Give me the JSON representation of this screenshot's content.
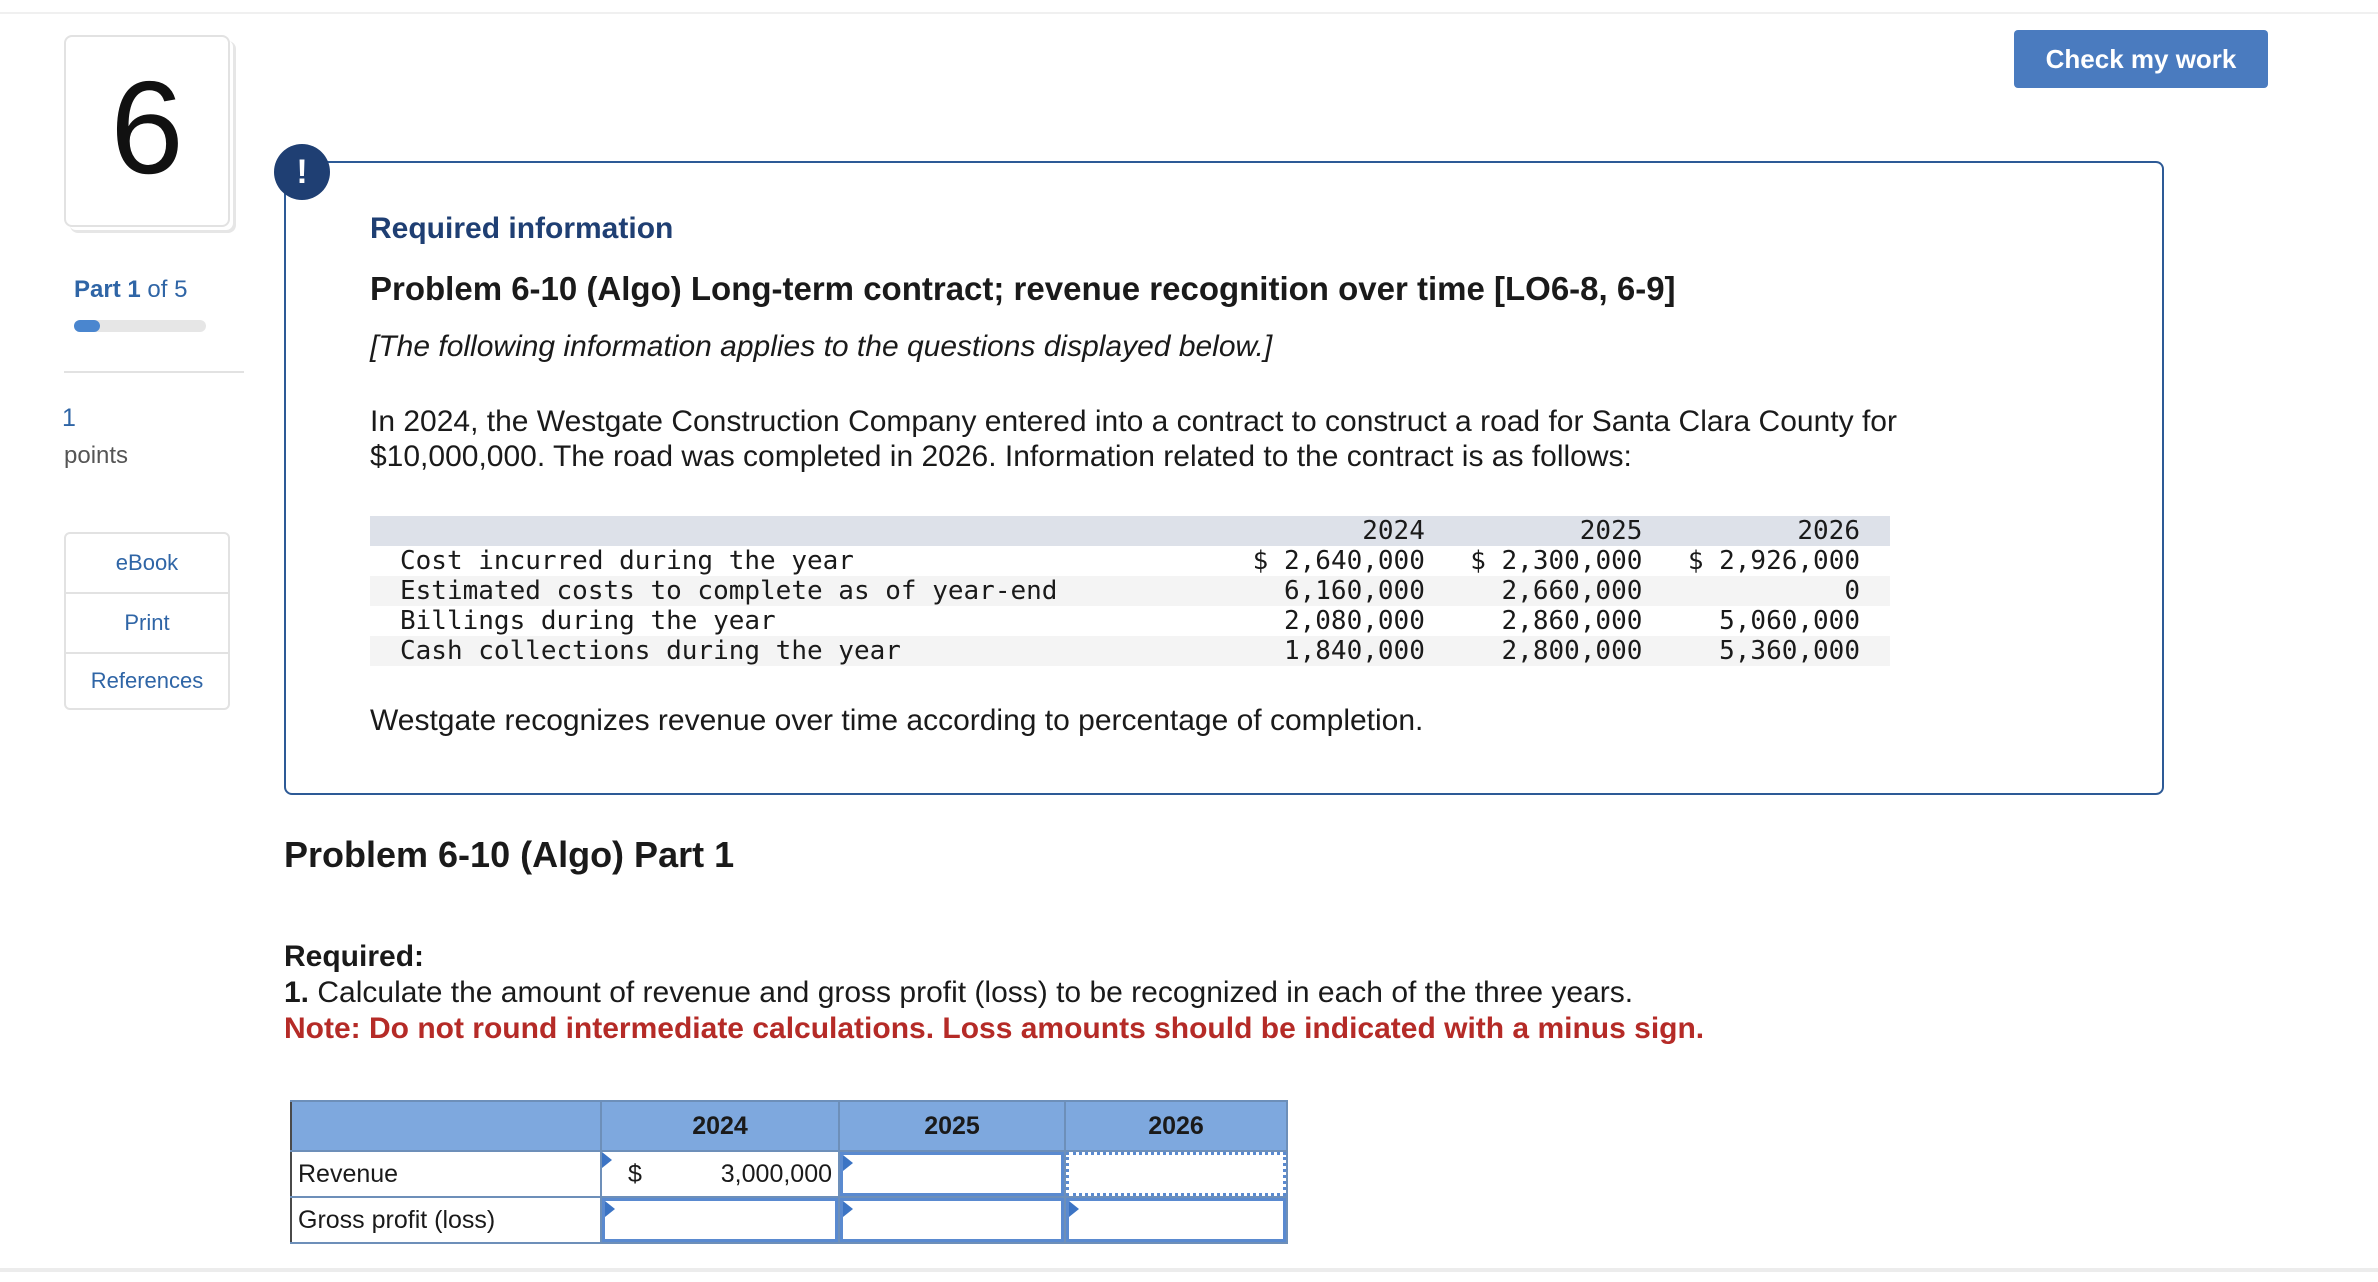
{
  "question_number": "6",
  "part": {
    "prefix": "Part",
    "current": "1",
    "of_text": "of 5",
    "progress_fraction": 0.2
  },
  "points": {
    "value": "1",
    "label": "points"
  },
  "side_links": [
    "eBook",
    "Print",
    "References"
  ],
  "check_button": "Check my work",
  "alert_icon": "!",
  "info_box": {
    "heading": "Required information",
    "title": "Problem 6-10 (Algo) Long-term contract; revenue recognition over time [LO6-8, 6-9]",
    "note": "[The following information applies to the questions displayed below.]",
    "paragraph": "In 2024, the Westgate Construction Company entered into a contract to construct a road for Santa Clara County for $10,000,000. The road was completed in 2026. Information related to the contract is as follows:",
    "table": {
      "headers": [
        "2024",
        "2025",
        "2026"
      ],
      "rows": [
        {
          "label": "Cost incurred during the year",
          "values": [
            "$ 2,640,000",
            "$ 2,300,000",
            "$ 2,926,000"
          ]
        },
        {
          "label": "Estimated costs to complete as of year-end",
          "values": [
            "6,160,000",
            "2,660,000",
            "0"
          ]
        },
        {
          "label": "Billings during the year",
          "values": [
            "2,080,000",
            "2,860,000",
            "5,060,000"
          ]
        },
        {
          "label": "Cash collections during the year",
          "values": [
            "1,840,000",
            "2,800,000",
            "5,360,000"
          ]
        }
      ]
    },
    "closing": "Westgate recognizes revenue over time according to percentage of completion."
  },
  "part_heading": "Problem 6-10 (Algo) Part 1",
  "required": {
    "label": "Required:",
    "item_number": "1.",
    "item_text": " Calculate the amount of revenue and gross profit (loss) to be recognized in each of the three years.",
    "note": "Note: Do not round intermediate calculations. Loss amounts should be indicated with a minus sign."
  },
  "answer_table": {
    "headers": [
      "2024",
      "2025",
      "2026"
    ],
    "rows": [
      {
        "label": "Revenue",
        "currency": "$",
        "values": [
          "3,000,000",
          "",
          ""
        ]
      },
      {
        "label": "Gross profit (loss)",
        "values": [
          "",
          "",
          ""
        ]
      }
    ]
  }
}
